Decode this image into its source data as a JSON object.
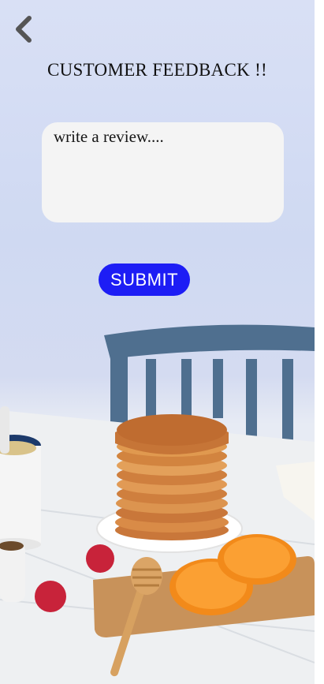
{
  "header": {
    "back_icon": "chevron-left-icon",
    "title": "CUSTOMER FEEDBACK !!"
  },
  "review": {
    "placeholder": "write a review....",
    "value": ""
  },
  "submit": {
    "label": "SUBMIT",
    "color": "#1d1df5"
  },
  "background": {
    "description_icon": "pancakes-breakfast-photo"
  }
}
